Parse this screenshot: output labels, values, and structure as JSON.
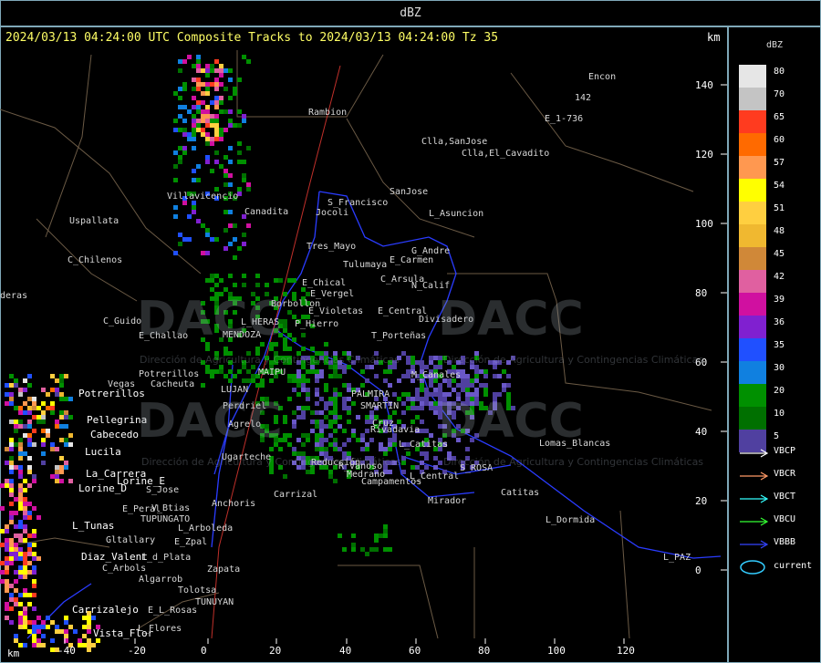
{
  "window": {
    "title": "dBZ"
  },
  "header": {
    "text": "2024/03/13 04:24:00 UTC Composite Tracks to 2024/03/13 04:24:00 Tz 35",
    "km_unit_top": "km",
    "km_unit_bottom": "km"
  },
  "axes": {
    "y_ticks": [
      "140",
      "120",
      "100",
      "80",
      "60",
      "40",
      "20",
      "0"
    ],
    "x_ticks": [
      "-40",
      "-20",
      "0",
      "20",
      "40",
      "60",
      "80",
      "100",
      "120"
    ]
  },
  "watermark": {
    "logo_text": "DACC",
    "subtitle": "Dirección de Agricultura y Contingencias Climáticas"
  },
  "map_labels_grey": [
    "Encon",
    "142",
    "E_1-736",
    "Rambion",
    "Clla,SanJose",
    "Clla,El_Cavadito",
    "SanJose",
    "Villavicencio",
    "Uspallata",
    "C_Chilenos",
    "Canadita",
    "S_Francisco",
    "Jocoli",
    "L_Asuncion",
    "Tres_Mayo",
    "G_Andre",
    "Tulumaya",
    "E_Carmen",
    "E_Chical",
    "C_Arsula",
    "E_Vergel",
    "N_Calif",
    "Borbollon",
    "E_Violetas",
    "E_Central",
    "Divisadero",
    "P_Hierro",
    "C_Guido",
    "L_HERAS",
    "MENDOZA",
    "E_Challao",
    "T_Porteñas",
    "Potrerillos",
    "Cacheuta",
    "Vegas",
    "LUJAN",
    "Perdriel",
    "Agrelo",
    "Ugarteche",
    "Carrizal",
    "Anchoris",
    "E_Peral",
    "V_Btias",
    "TUPUNGATO",
    "L_Arboleda",
    "Gltallary",
    "E_Zpal",
    "L_d_Plata",
    "C_Arbols",
    "Algarrob",
    "Zapata",
    "Tolotsa",
    "E_L_Rosas",
    "TUNUYAN",
    "L_Flores",
    "Mirador",
    "Campamentos",
    "L_Central",
    "S_ROSA",
    "Catitas",
    "L_Dormida",
    "Lomas_Blancas",
    "L_PAZ",
    "R_Vanoso",
    "S_Jose",
    "Reducción",
    "Medrano",
    "deras",
    "M_Canales",
    "MAIPU",
    "Rivadavia",
    "SMARTIN",
    "PALMIRA",
    "Cruz",
    "L_Catitas"
  ],
  "map_labels_white": [
    "Potrerillos",
    "Pellegrina",
    "Cabecedo",
    "Lucila",
    "La_Carrera",
    "Lorine_E",
    "Lorine_D",
    "L_Tunas",
    "Diaz_Valent",
    "Carrizalejo",
    "Vista_Flor"
  ],
  "legend": {
    "title": "dBZ",
    "scale": [
      {
        "value": "80",
        "color": "#e6e6e6"
      },
      {
        "value": "70",
        "color": "#c4c4c4"
      },
      {
        "value": "65",
        "color": "#ff3b1f"
      },
      {
        "value": "60",
        "color": "#ff6a00"
      },
      {
        "value": "57",
        "color": "#ff9850"
      },
      {
        "value": "54",
        "color": "#ffff00"
      },
      {
        "value": "51",
        "color": "#ffcf40"
      },
      {
        "value": "48",
        "color": "#f0b830"
      },
      {
        "value": "45",
        "color": "#d08838"
      },
      {
        "value": "42",
        "color": "#e060a0"
      },
      {
        "value": "39",
        "color": "#d010a0"
      },
      {
        "value": "36",
        "color": "#8020d0"
      },
      {
        "value": "35",
        "color": "#2050ff"
      },
      {
        "value": "30",
        "color": "#1080e0"
      },
      {
        "value": "20",
        "color": "#009000"
      },
      {
        "value": "10",
        "color": "#007000"
      },
      {
        "value": "5",
        "color": "#5040a0"
      }
    ],
    "tracks": [
      {
        "label": "VBCP",
        "color": "#ffffff"
      },
      {
        "label": "VBCR",
        "color": "#ff9966"
      },
      {
        "label": "VBCT",
        "color": "#33ffff"
      },
      {
        "label": "VBCU",
        "color": "#33ff33"
      },
      {
        "label": "VBBB",
        "color": "#3344ff"
      }
    ],
    "current_label": "current",
    "current_color": "#33ccff"
  }
}
